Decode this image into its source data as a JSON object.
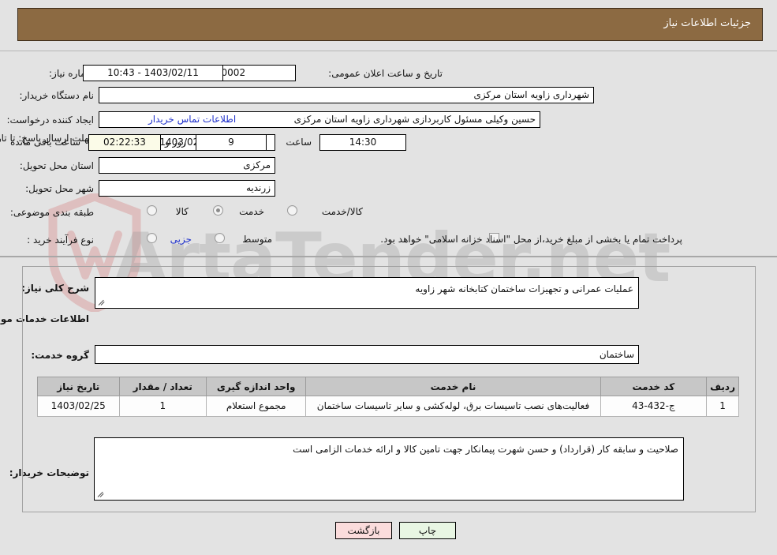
{
  "header": {
    "title": "جزئیات اطلاعات نیاز"
  },
  "top_form": {
    "need_number_label": "شماره نیاز:",
    "need_number_value": "1103050162000002",
    "public_announce_label": "تاریخ و ساعت اعلان عمومی:",
    "public_announce_value": "1403/02/11 - 10:43",
    "buyer_org_label": "نام دستگاه خریدار:",
    "buyer_org_value": "شهرداری زاویه استان مرکزی",
    "creator_label": "ایجاد کننده درخواست:",
    "creator_value": "حسین وکیلی مسئول کاربردازی شهرداری زاویه استان مرکزی",
    "contact_link": "اطلاعات تماس خریدار",
    "deadline_label": "مهلت ارسال پاسخ: تا تاریخ:",
    "deadline_date": "1403/02/20",
    "hour_label": "ساعت",
    "deadline_time": "14:30",
    "days_remaining": "9",
    "days_word": "روز و",
    "countdown": "02:22:33",
    "remaining_suffix": "ساعت باقی مانده",
    "province_label": "استان محل تحویل:",
    "province_value": "مرکزی",
    "city_label": "شهر محل تحویل:",
    "city_value": "زرندیه",
    "classification_label": "طبقه بندی موضوعی:",
    "classification_options": [
      "کالا",
      "خدمت",
      "کالا/خدمت"
    ],
    "classification_selected": "خدمت",
    "process_type_label": "نوع فرآیند خرید :",
    "process_type_options": [
      "جزیی",
      "متوسط"
    ],
    "process_type_selected": "",
    "treasury_note": "پرداخت تمام یا بخشی از مبلغ خرید،از محل \"اسناد خزانه اسلامی\" خواهد بود.",
    "treasury_checked": false
  },
  "body": {
    "summary_label": "شرح کلی نیاز:",
    "summary_value": "عملیات عمرانی و تجهیزات ساختمان کتابخانه شهر زاویه",
    "services_heading": "اطلاعات خدمات مورد نیاز",
    "service_group_label": "گروه خدمت:",
    "service_group_value": "ساختمان",
    "buyer_notes_label": "توضیحات خریدار:",
    "buyer_notes_value": "صلاحیت و سابقه کار (قرارداد) و حسن شهرت پیمانکار جهت تامین کالا و ارائه خدمات الزامی است"
  },
  "table": {
    "columns": [
      "ردیف",
      "کد خدمت",
      "نام خدمت",
      "واحد اندازه گیری",
      "تعداد / مقدار",
      "تاریخ نیاز"
    ],
    "rows": [
      {
        "radif": "1",
        "code": "ج-432-43",
        "name": "فعالیت‌های نصب تاسیسات برق، لوله‌کشی و سایر تاسیسات ساختمان",
        "unit": "مجموع استعلام",
        "qty": "1",
        "date": "1403/02/25"
      }
    ]
  },
  "footer": {
    "print_label": "چاپ",
    "back_label": "بازگشت"
  },
  "watermark": {
    "text": "ArtaTender.net"
  },
  "colors": {
    "header_brown": "#8c6a42",
    "page_bg": "#e3e3e3",
    "link_blue": "#2233cc",
    "table_header": "#c7c7c7",
    "print_green": "#e8f6e3",
    "back_pink": "#fbdcdc",
    "countdown_cream": "#fbfbe8"
  }
}
